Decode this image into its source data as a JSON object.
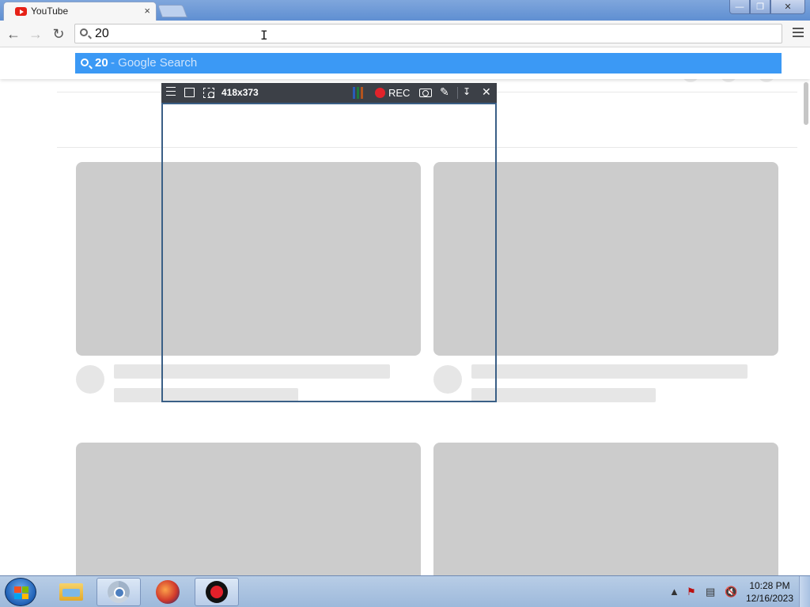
{
  "browser": {
    "tab_title": "YouTube",
    "tab_close": "×",
    "window_buttons": {
      "minimize": "—",
      "maximize": "❐",
      "close": "✕"
    },
    "omnibox_value": "20",
    "suggestion": {
      "query": "20",
      "suffix": " - Google Search"
    }
  },
  "recorder": {
    "dimensions": "418x373",
    "rec_label": "REC",
    "colors": [
      "#2a5bb8",
      "#1f7a3a",
      "#b3541e"
    ]
  },
  "taskbar": {
    "apps": [
      "windows-explorer",
      "chrome",
      "firefox",
      "screen-recorder"
    ],
    "clock_time": "10:28 PM",
    "clock_date": "12/16/2023"
  }
}
